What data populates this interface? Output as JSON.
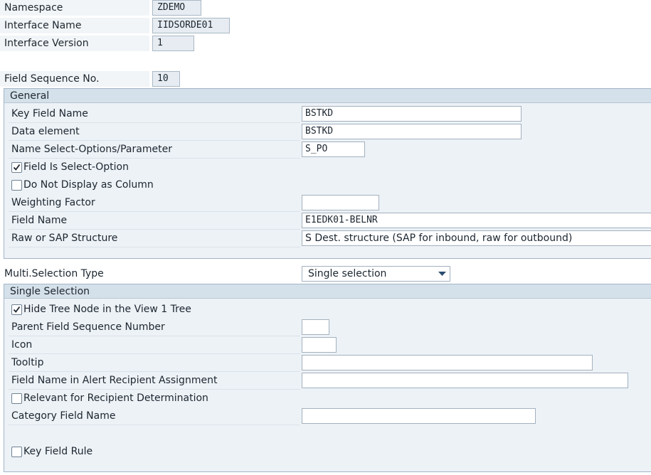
{
  "header": {
    "namespace_label": "Namespace",
    "namespace_value": "ZDEMO",
    "interface_name_label": "Interface Name",
    "interface_name_value": "IIDSORDE01",
    "interface_version_label": "Interface Version",
    "interface_version_value": "1",
    "field_sequence_label": "Field Sequence No.",
    "field_sequence_value": "10"
  },
  "general": {
    "title": "General",
    "key_field_name_label": "Key Field Name",
    "key_field_name_value": "BSTKD",
    "data_element_label": "Data element",
    "data_element_value": "BSTKD",
    "name_select_label": "Name Select-Options/Parameter",
    "name_select_value": "S_PO",
    "field_is_select_option_label": "Field Is Select-Option",
    "field_is_select_option_checked": true,
    "do_not_display_label": "Do Not Display as Column",
    "do_not_display_checked": false,
    "weighting_factor_label": "Weighting Factor",
    "weighting_factor_value": "",
    "field_name_label": "Field Name",
    "field_name_value": "E1EDK01-BELNR",
    "raw_or_sap_label": "Raw or SAP Structure",
    "raw_or_sap_value": "S Dest. structure (SAP for inbound, raw for outbound)"
  },
  "multi_selection": {
    "label": "Multi.Selection Type",
    "selected": "Single selection"
  },
  "single_selection": {
    "title": "Single Selection",
    "hide_tree_node_label": "Hide Tree Node in the View 1 Tree",
    "hide_tree_node_checked": true,
    "parent_field_seq_label": "Parent Field Sequence Number",
    "parent_field_seq_value": "",
    "icon_label": "Icon",
    "icon_value": "",
    "tooltip_label": "Tooltip",
    "tooltip_value": "",
    "alert_recipient_label": "Field Name in Alert Recipient Assignment",
    "alert_recipient_value": "",
    "relevant_recipient_label": "Relevant for Recipient Determination",
    "relevant_recipient_checked": false,
    "category_field_label": "Category Field Name",
    "category_field_value": "",
    "key_field_rule_label": "Key Field Rule",
    "key_field_rule_checked": false
  },
  "colors": {
    "group_background": "#edf2f6",
    "group_header": "#d5e1ea",
    "readonly_field": "#e6ecf1"
  }
}
